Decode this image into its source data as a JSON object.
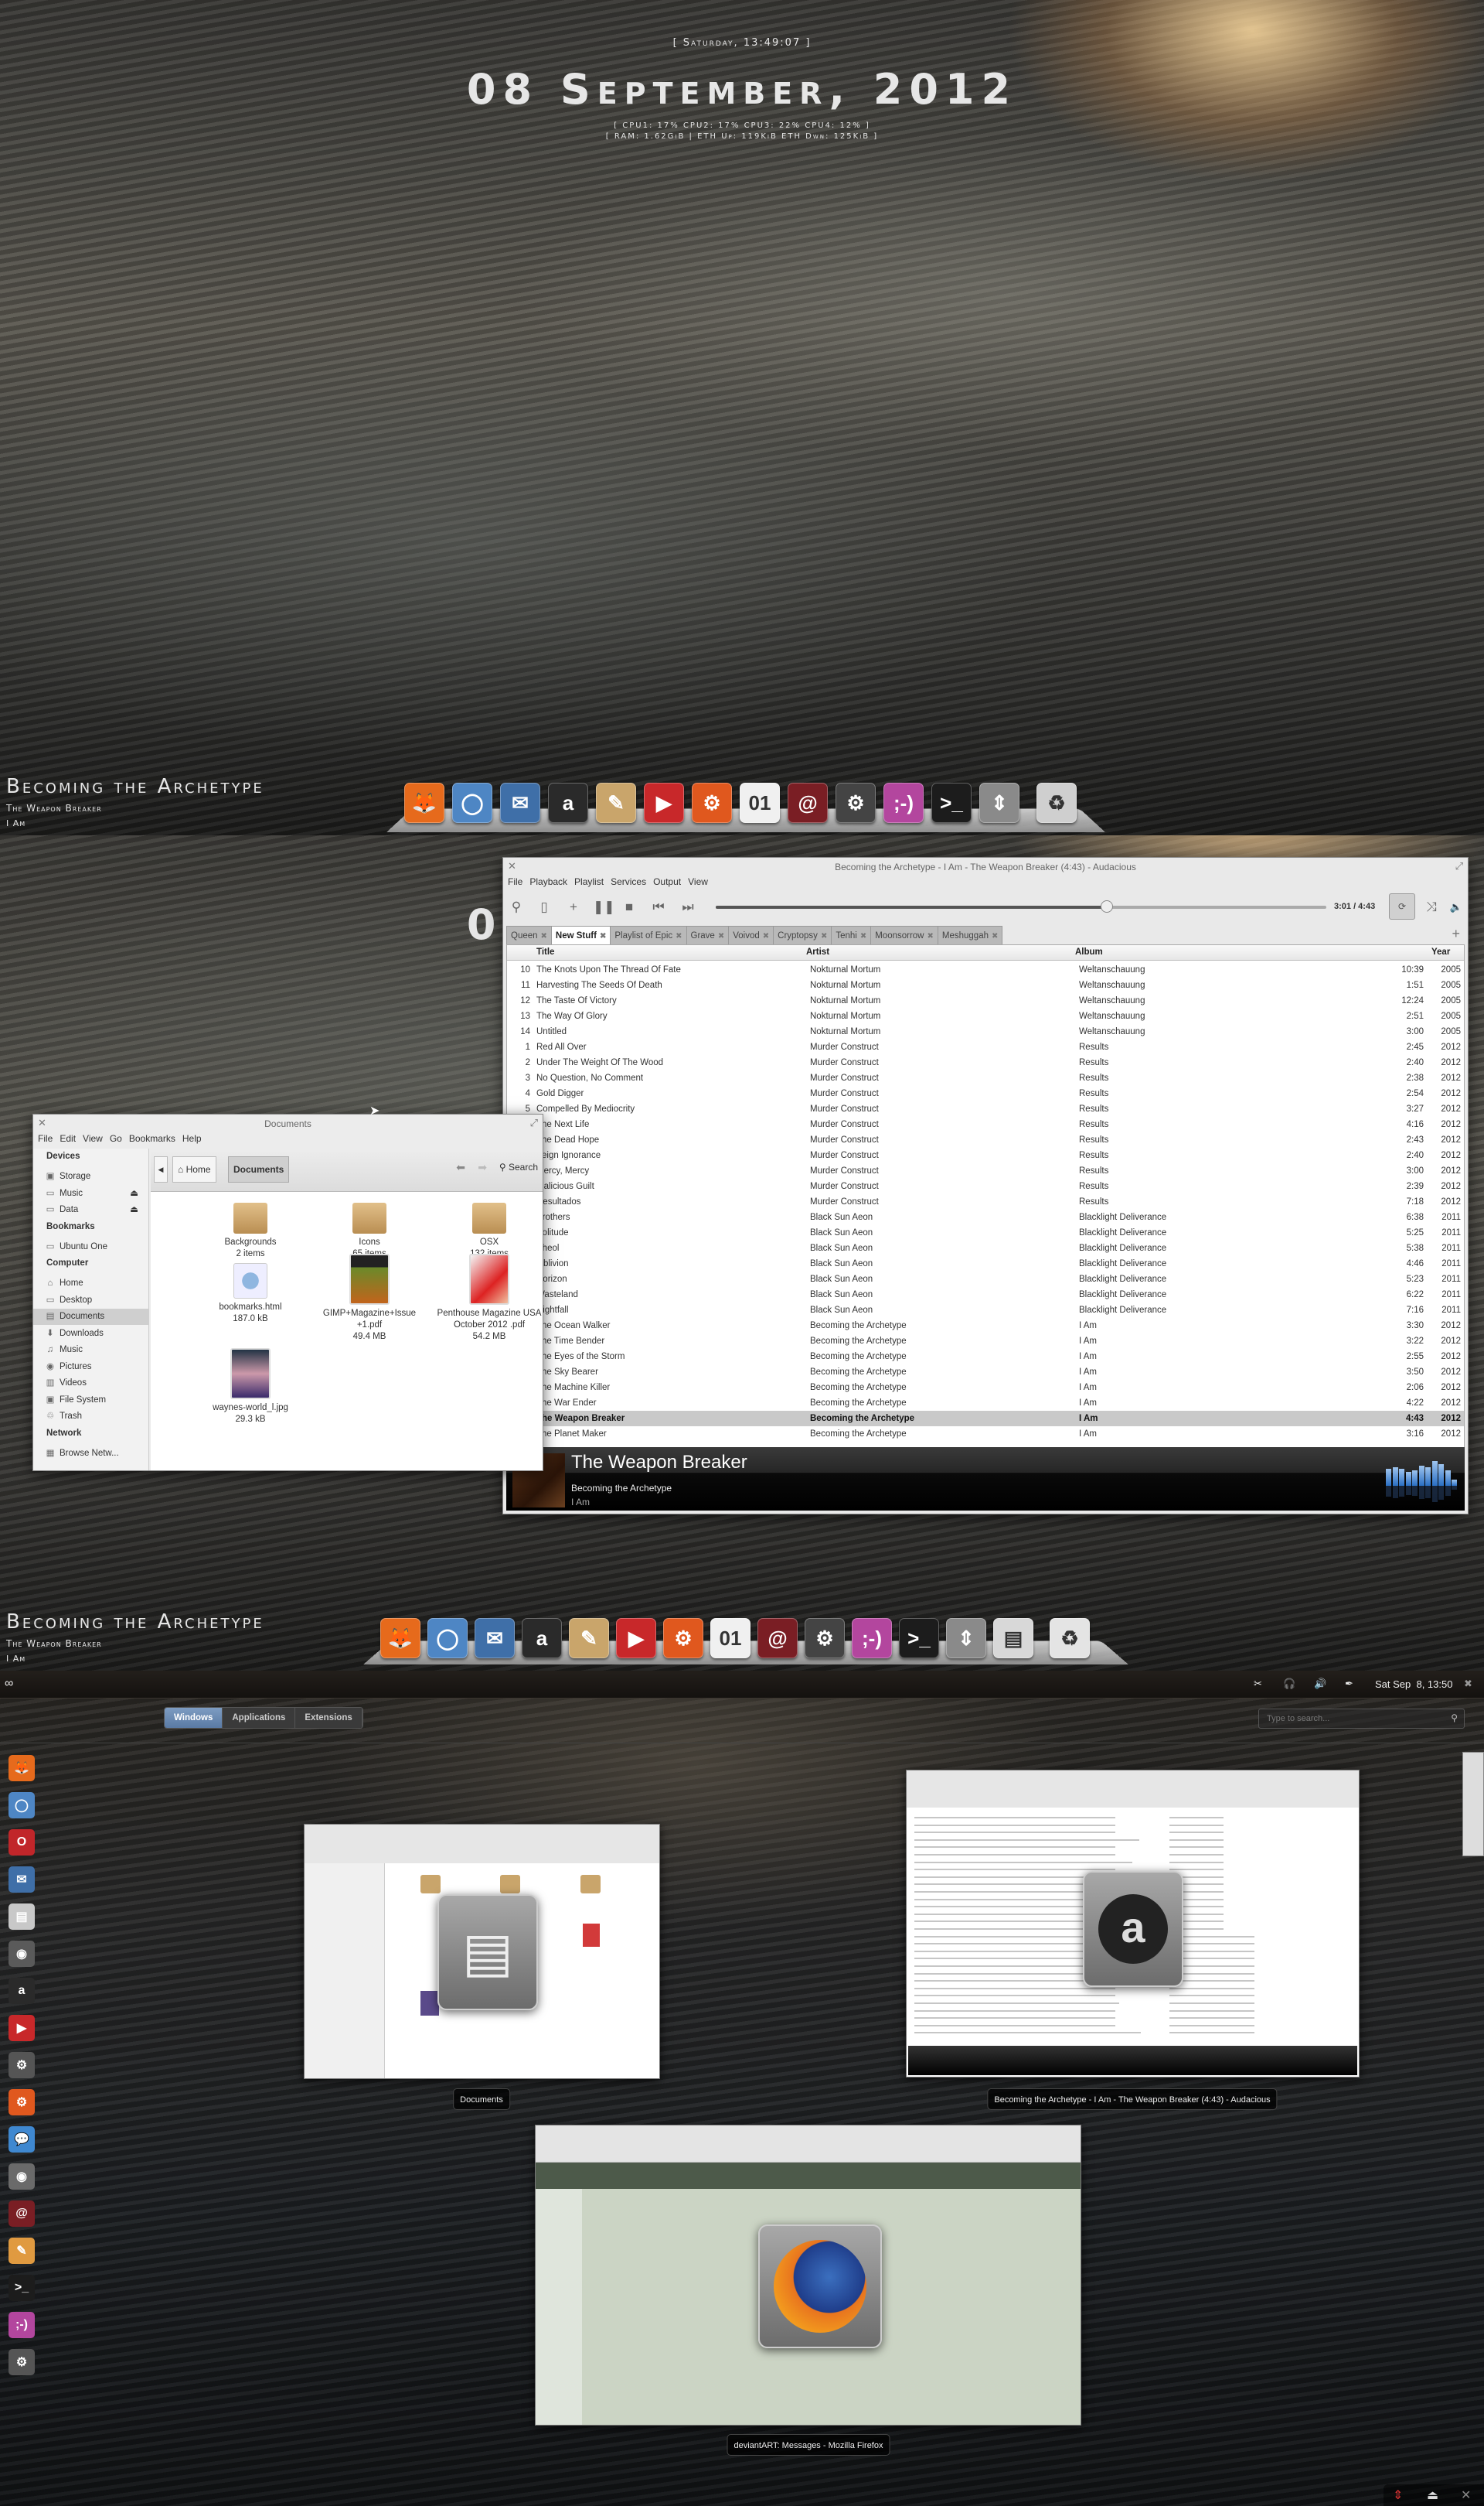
{
  "conky": {
    "day_time": "[ Saturday, 13:49:07 ]",
    "date": "08 September, 2012",
    "cpu": "[ CPU1: 17% CPU2: 17% CPU3: 22% CPU4: 12% ]",
    "net": "[ RAM: 1.62GiB | ETH Up: 119KiB ETH Dwn: 125KiB ]"
  },
  "now_playing": {
    "title": "Becoming the Archetype",
    "track": "The Weapon Breaker",
    "album": "I Am"
  },
  "dock_top": [
    {
      "icon": "firefox-icon",
      "glyph": "🦊",
      "color": "#e66a1c"
    },
    {
      "icon": "chromium-icon",
      "glyph": "◯",
      "color": "#4e86c4"
    },
    {
      "icon": "thunderbird-icon",
      "glyph": "✉",
      "color": "#3f6fa8"
    },
    {
      "icon": "audacious-icon",
      "glyph": "a",
      "color": "#2a2a2a"
    },
    {
      "icon": "gimp-icon",
      "glyph": "✎",
      "color": "#c9a56b"
    },
    {
      "icon": "video-player-icon",
      "glyph": "▶",
      "color": "#c8282a"
    },
    {
      "icon": "settings-icon",
      "glyph": "⚙",
      "color": "#e0581e"
    },
    {
      "icon": "calendar-icon",
      "glyph": "01",
      "color": "#f0f0f0"
    },
    {
      "icon": "mail-icon",
      "glyph": "@",
      "color": "#7a1e24"
    },
    {
      "icon": "system-monitor-icon",
      "glyph": "⚙",
      "color": "#444444"
    },
    {
      "icon": "empathy-icon",
      "glyph": ";-)",
      "color": "#b3469e"
    },
    {
      "icon": "terminal-icon",
      "glyph": ">_",
      "color": "#1c1c1c"
    },
    {
      "icon": "update-manager-icon",
      "glyph": "⇕",
      "color": "#8a8a8a"
    },
    {
      "icon": "trash-icon",
      "glyph": "♻",
      "color": "#cfcfcf"
    }
  ],
  "dock_mid": [
    {
      "icon": "firefox-icon",
      "glyph": "🦊",
      "color": "#e66a1c"
    },
    {
      "icon": "chromium-icon",
      "glyph": "◯",
      "color": "#4e86c4"
    },
    {
      "icon": "thunderbird-icon",
      "glyph": "✉",
      "color": "#3f6fa8"
    },
    {
      "icon": "audacious-icon",
      "glyph": "a",
      "color": "#2a2a2a"
    },
    {
      "icon": "gimp-icon",
      "glyph": "✎",
      "color": "#c9a56b"
    },
    {
      "icon": "video-player-icon",
      "glyph": "▶",
      "color": "#c8282a"
    },
    {
      "icon": "settings-icon",
      "glyph": "⚙",
      "color": "#e0581e"
    },
    {
      "icon": "calendar-icon",
      "glyph": "01",
      "color": "#f0f0f0"
    },
    {
      "icon": "mail-icon",
      "glyph": "@",
      "color": "#7a1e24"
    },
    {
      "icon": "system-monitor-icon",
      "glyph": "⚙",
      "color": "#444444"
    },
    {
      "icon": "empathy-icon",
      "glyph": ";-)",
      "color": "#b3469e"
    },
    {
      "icon": "terminal-icon",
      "glyph": ">_",
      "color": "#1c1c1c"
    },
    {
      "icon": "update-manager-icon",
      "glyph": "⇕",
      "color": "#8a8a8a"
    },
    {
      "icon": "file-manager-icon",
      "glyph": "▤",
      "color": "#d8d8d8"
    },
    {
      "icon": "trash-icon",
      "glyph": "♻",
      "color": "#e4e4e4"
    }
  ],
  "audacious": {
    "window_title": "Becoming the Archetype - I Am - The Weapon Breaker (4:43) - Audacious",
    "menu": [
      "File",
      "Playback",
      "Playlist",
      "Services",
      "Output",
      "View"
    ],
    "time": "3:01 / 4:43",
    "progress": 0.64,
    "tabs": [
      {
        "label": "Queen",
        "active": false
      },
      {
        "label": "New Stuff",
        "active": true
      },
      {
        "label": "Playlist of Epic",
        "active": false
      },
      {
        "label": "Grave",
        "active": false
      },
      {
        "label": "Voivod",
        "active": false
      },
      {
        "label": "Cryptopsy",
        "active": false
      },
      {
        "label": "Tenhi",
        "active": false
      },
      {
        "label": "Moonsorrow",
        "active": false
      },
      {
        "label": "Meshuggah",
        "active": false
      }
    ],
    "columns": {
      "title": "Title",
      "artist": "Artist",
      "album": "Album",
      "year": "Year"
    },
    "rows": [
      [
        "10",
        "The Knots Upon The Thread Of Fate",
        "Nokturnal Mortum",
        "Weltanschauung",
        "10:39",
        "2005"
      ],
      [
        "11",
        "Harvesting The Seeds Of Death",
        "Nokturnal Mortum",
        "Weltanschauung",
        "1:51",
        "2005"
      ],
      [
        "12",
        "The Taste Of Victory",
        "Nokturnal Mortum",
        "Weltanschauung",
        "12:24",
        "2005"
      ],
      [
        "13",
        "The Way Of Glory",
        "Nokturnal Mortum",
        "Weltanschauung",
        "2:51",
        "2005"
      ],
      [
        "14",
        "Untitled",
        "Nokturnal Mortum",
        "Weltanschauung",
        "3:00",
        "2005"
      ],
      [
        "1",
        "Red All Over",
        "Murder Construct",
        "Results",
        "2:45",
        "2012"
      ],
      [
        "2",
        "Under The Weight Of The Wood",
        "Murder Construct",
        "Results",
        "2:40",
        "2012"
      ],
      [
        "3",
        "No Question, No Comment",
        "Murder Construct",
        "Results",
        "2:38",
        "2012"
      ],
      [
        "4",
        "Gold Digger",
        "Murder Construct",
        "Results",
        "2:54",
        "2012"
      ],
      [
        "5",
        "Compelled By Mediocrity",
        "Murder Construct",
        "Results",
        "3:27",
        "2012"
      ],
      [
        "",
        "The Next Life",
        "Murder Construct",
        "Results",
        "4:16",
        "2012"
      ],
      [
        "",
        "The Dead Hope",
        "Murder Construct",
        "Results",
        "2:43",
        "2012"
      ],
      [
        "",
        "Feign Ignorance",
        "Murder Construct",
        "Results",
        "2:40",
        "2012"
      ],
      [
        "",
        "Mercy, Mercy",
        "Murder Construct",
        "Results",
        "3:00",
        "2012"
      ],
      [
        "",
        "Malicious Guilt",
        "Murder Construct",
        "Results",
        "2:39",
        "2012"
      ],
      [
        "",
        "Resultados",
        "Murder Construct",
        "Results",
        "7:18",
        "2012"
      ],
      [
        "",
        "Brothers",
        "Black Sun Aeon",
        "Blacklight Deliverance",
        "6:38",
        "2011"
      ],
      [
        "",
        "Solitude",
        "Black Sun Aeon",
        "Blacklight Deliverance",
        "5:25",
        "2011"
      ],
      [
        "",
        "Sheol",
        "Black Sun Aeon",
        "Blacklight Deliverance",
        "5:38",
        "2011"
      ],
      [
        "",
        "Oblivion",
        "Black Sun Aeon",
        "Blacklight Deliverance",
        "4:46",
        "2011"
      ],
      [
        "",
        "Horizon",
        "Black Sun Aeon",
        "Blacklight Deliverance",
        "5:23",
        "2011"
      ],
      [
        "",
        "Wasteland",
        "Black Sun Aeon",
        "Blacklight Deliverance",
        "6:22",
        "2011"
      ],
      [
        "",
        "Nightfall",
        "Black Sun Aeon",
        "Blacklight Deliverance",
        "7:16",
        "2011"
      ],
      [
        "",
        "The Ocean Walker",
        "Becoming the Archetype",
        "I Am",
        "3:30",
        "2012"
      ],
      [
        "",
        "The Time Bender",
        "Becoming the Archetype",
        "I Am",
        "3:22",
        "2012"
      ],
      [
        "",
        "The Eyes of the Storm",
        "Becoming the Archetype",
        "I Am",
        "2:55",
        "2012"
      ],
      [
        "",
        "The Sky Bearer",
        "Becoming the Archetype",
        "I Am",
        "3:50",
        "2012"
      ],
      [
        "",
        "The Machine Killer",
        "Becoming the Archetype",
        "I Am",
        "2:06",
        "2012"
      ],
      [
        "",
        "The War Ender",
        "Becoming the Archetype",
        "I Am",
        "4:22",
        "2012"
      ],
      [
        "",
        "The Weapon Breaker",
        "Becoming the Archetype",
        "I Am",
        "4:43",
        "2012"
      ],
      [
        "",
        "The Planet Maker",
        "Becoming the Archetype",
        "I Am",
        "3:16",
        "2012"
      ]
    ],
    "selected_row": 29,
    "info": {
      "title": "The Weapon Breaker",
      "artist": "Becoming the Archetype",
      "album": "I Am"
    },
    "visualizer_levels": [
      0.55,
      0.6,
      0.55,
      0.45,
      0.5,
      0.65,
      0.6,
      0.8,
      0.7,
      0.5,
      0.2
    ]
  },
  "files": {
    "window_title": "Documents",
    "menu": [
      "File",
      "Edit",
      "View",
      "Go",
      "Bookmarks",
      "Help"
    ],
    "sidebar": [
      {
        "type": "header",
        "label": "Devices"
      },
      {
        "type": "item",
        "label": "Storage",
        "icon": "drive-icon",
        "glyph": "▣"
      },
      {
        "type": "item",
        "label": "Music",
        "icon": "drive-icon",
        "glyph": "▭",
        "eject": true
      },
      {
        "type": "item",
        "label": "Data",
        "icon": "drive-icon",
        "glyph": "▭",
        "eject": true
      },
      {
        "type": "header",
        "label": "Bookmarks"
      },
      {
        "type": "item",
        "label": "Ubuntu One",
        "icon": "folder-icon",
        "glyph": "▭"
      },
      {
        "type": "header",
        "label": "Computer"
      },
      {
        "type": "item",
        "label": "Home",
        "icon": "home-icon",
        "glyph": "⌂"
      },
      {
        "type": "item",
        "label": "Desktop",
        "icon": "desktop-icon",
        "glyph": "▭"
      },
      {
        "type": "item",
        "label": "Documents",
        "icon": "documents-icon",
        "glyph": "▤",
        "active": true
      },
      {
        "type": "item",
        "label": "Downloads",
        "icon": "downloads-icon",
        "glyph": "⬇"
      },
      {
        "type": "item",
        "label": "Music",
        "icon": "music-icon",
        "glyph": "♫"
      },
      {
        "type": "item",
        "label": "Pictures",
        "icon": "camera-icon",
        "glyph": "◉"
      },
      {
        "type": "item",
        "label": "Videos",
        "icon": "film-icon",
        "glyph": "▥"
      },
      {
        "type": "item",
        "label": "File System",
        "icon": "harddisk-icon",
        "glyph": "▣"
      },
      {
        "type": "item",
        "label": "Trash",
        "icon": "trash-icon",
        "glyph": "♲"
      },
      {
        "type": "header",
        "label": "Network"
      },
      {
        "type": "item",
        "label": "Browse Netw...",
        "icon": "network-icon",
        "glyph": "▦"
      }
    ],
    "path": [
      "Home",
      "Documents"
    ],
    "search_label": "Search",
    "items": [
      {
        "name": "Backgrounds",
        "meta": "2 items",
        "kind": "folder"
      },
      {
        "name": "Icons",
        "meta": "65 items",
        "kind": "folder"
      },
      {
        "name": "OSX",
        "meta": "132 items",
        "kind": "folder"
      },
      {
        "name": "bookmarks.html",
        "meta": "187.0 kB",
        "kind": "html"
      },
      {
        "name": "GIMP+Magazine+Issue +1.pdf",
        "meta": "49.4 MB",
        "kind": "pdf-green"
      },
      {
        "name": "Penthouse Magazine USA October 2012 .pdf",
        "meta": "54.2 MB",
        "kind": "pdf-red"
      },
      {
        "name": "waynes-world_l.jpg",
        "meta": "29.3 kB",
        "kind": "photo"
      }
    ]
  },
  "shell": {
    "clock": "Sat Sep  8, 13:50",
    "tabs": [
      {
        "label": "Windows",
        "active": true
      },
      {
        "label": "Applications",
        "active": false
      },
      {
        "label": "Extensions",
        "active": false
      }
    ],
    "search_placeholder": "Type to search...",
    "dash": [
      {
        "icon": "firefox-icon",
        "glyph": "🦊",
        "color": "#e66a1c"
      },
      {
        "icon": "chromium-icon",
        "glyph": "◯",
        "color": "#4e86c4"
      },
      {
        "icon": "opera-icon",
        "glyph": "O",
        "color": "#c1262a"
      },
      {
        "icon": "thunderbird-icon",
        "glyph": "✉",
        "color": "#3f6fa8"
      },
      {
        "icon": "file-manager-icon",
        "glyph": "▤",
        "color": "#c8c8c8"
      },
      {
        "icon": "cheese-icon",
        "glyph": "◉",
        "color": "#5a5a5a"
      },
      {
        "icon": "audacious-icon",
        "glyph": "a",
        "color": "#2a2a2a"
      },
      {
        "icon": "video-player-icon",
        "glyph": "▶",
        "color": "#c8282a"
      },
      {
        "icon": "system-monitor-icon",
        "glyph": "⚙",
        "color": "#555555"
      },
      {
        "icon": "settings-icon",
        "glyph": "⚙",
        "color": "#e0581e"
      },
      {
        "icon": "chat-icon",
        "glyph": "💬",
        "color": "#3f88d0"
      },
      {
        "icon": "camera-icon",
        "glyph": "◉",
        "color": "#6a6a6a"
      },
      {
        "icon": "mail-icon",
        "glyph": "@",
        "color": "#7a1e24"
      },
      {
        "icon": "easytag-icon",
        "glyph": "✎",
        "color": "#e09a40"
      },
      {
        "icon": "terminal-icon",
        "glyph": ">_",
        "color": "#1c1c1c"
      },
      {
        "icon": "empathy-icon",
        "glyph": ";-)",
        "color": "#b3469e"
      },
      {
        "icon": "system-settings-icon",
        "glyph": "⚙",
        "color": "#555555"
      }
    ],
    "windows": [
      {
        "caption": "Documents"
      },
      {
        "caption": "Becoming the Archetype - I Am - The Weapon Breaker (4:43) - Audacious"
      },
      {
        "caption": "deviantART: Messages - Mozilla Firefox"
      }
    ]
  }
}
